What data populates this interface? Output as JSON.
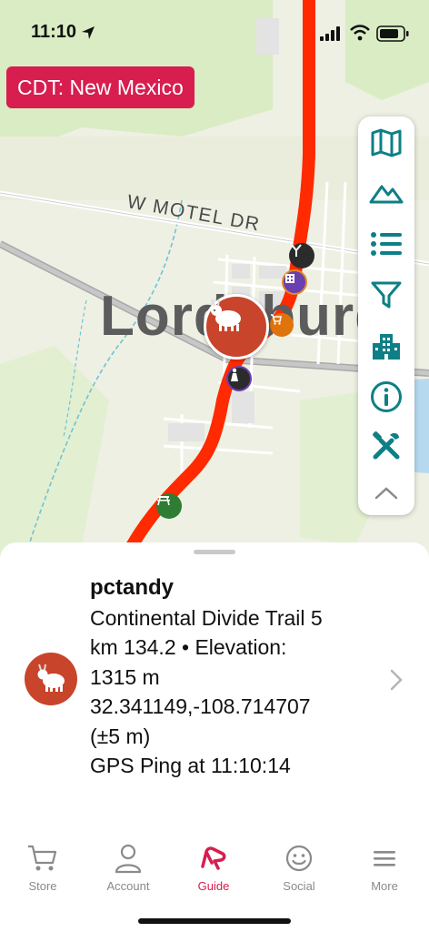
{
  "status_bar": {
    "time": "11:10",
    "icons": [
      "location-arrow-icon",
      "cellular-signal-icon",
      "wifi-icon",
      "battery-icon"
    ]
  },
  "map": {
    "region_badge": "CDT: New Mexico",
    "town_label": "Lordsburg",
    "street_label": "W MOTEL DR",
    "trail_color": "#ff2a00",
    "user_marker_color": "#c8442b"
  },
  "toolbar": {
    "accent": "#0e7f86",
    "tools": [
      "map-icon",
      "elevation-icon",
      "list-icon",
      "filter-icon",
      "town-icon",
      "info-icon",
      "tools-icon",
      "collapse-chevron-icon"
    ]
  },
  "sheet": {
    "name": "pctandy",
    "trail": "Continental Divide Trail 5",
    "km_elevation": "km 134.2 • Elevation:",
    "elevation_value": "1315 m",
    "coordinates": "32.341149,-108.714707",
    "accuracy": "(±5 m)",
    "ping": "GPS Ping at 11:10:14"
  },
  "tab_bar": {
    "active_color": "#d81d4f",
    "tabs": [
      {
        "label": "Store",
        "icon": "cart-icon"
      },
      {
        "label": "Account",
        "icon": "person-icon"
      },
      {
        "label": "Guide",
        "icon": "guide-logo-icon"
      },
      {
        "label": "Social",
        "icon": "smiley-icon"
      },
      {
        "label": "More",
        "icon": "menu-icon"
      }
    ]
  }
}
